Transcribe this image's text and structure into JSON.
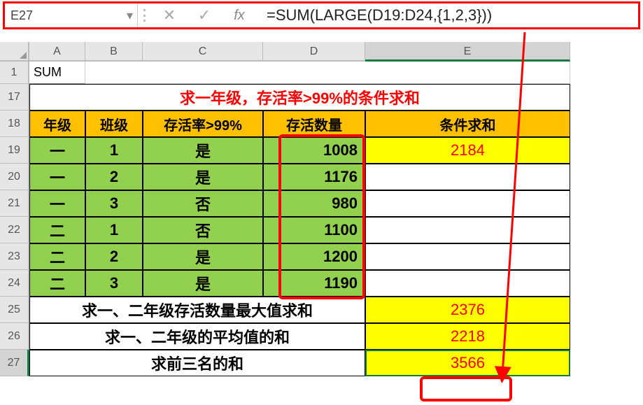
{
  "name_box": "E27",
  "formula": "=SUM(LARGE(D19:D24,{1,2,3}))",
  "fx_label": "fx",
  "columns": [
    "A",
    "B",
    "C",
    "D",
    "E"
  ],
  "rows": [
    "1",
    "17",
    "18",
    "19",
    "20",
    "21",
    "22",
    "23",
    "24",
    "25",
    "26",
    "27"
  ],
  "cells": {
    "A1": "SUM",
    "title": "求一年级，存活率>99%的条件求和",
    "headers": {
      "A": "年级",
      "B": "班级",
      "C": "存活率>99%",
      "D": "存活数量",
      "E": "条件求和"
    },
    "data": [
      {
        "A": "一",
        "B": "1",
        "C": "是",
        "D": "1008",
        "E19": "2184"
      },
      {
        "A": "一",
        "B": "2",
        "C": "是",
        "D": "1176"
      },
      {
        "A": "一",
        "B": "3",
        "C": "否",
        "D": "980"
      },
      {
        "A": "二",
        "B": "1",
        "C": "否",
        "D": "1100"
      },
      {
        "A": "二",
        "B": "2",
        "C": "是",
        "D": "1200"
      },
      {
        "A": "二",
        "B": "3",
        "C": "是",
        "D": "1190"
      }
    ],
    "summary": [
      {
        "label": "求一、二年级存活数量最大值求和",
        "value": "2376"
      },
      {
        "label": "求一、二年级的平均值的和",
        "value": "2218"
      },
      {
        "label": "求前三名的和",
        "value": "3566"
      }
    ]
  },
  "chart_data": {
    "type": "table",
    "title": "求一年级，存活率>99%的条件求和",
    "columns": [
      "年级",
      "班级",
      "存活率>99%",
      "存活数量",
      "条件求和"
    ],
    "rows": [
      [
        "一",
        1,
        "是",
        1008,
        2184
      ],
      [
        "一",
        2,
        "是",
        1176,
        null
      ],
      [
        "一",
        3,
        "否",
        980,
        null
      ],
      [
        "二",
        1,
        "否",
        1100,
        null
      ],
      [
        "二",
        2,
        "是",
        1200,
        null
      ],
      [
        "二",
        3,
        "是",
        1190,
        null
      ]
    ],
    "summary_rows": [
      [
        "求一、二年级存活数量最大值求和",
        2376
      ],
      [
        "求一、二年级的平均值的和",
        2218
      ],
      [
        "求前三名的和",
        3566
      ]
    ],
    "formula": "=SUM(LARGE(D19:D24,{1,2,3}))",
    "active_cell": "E27"
  }
}
